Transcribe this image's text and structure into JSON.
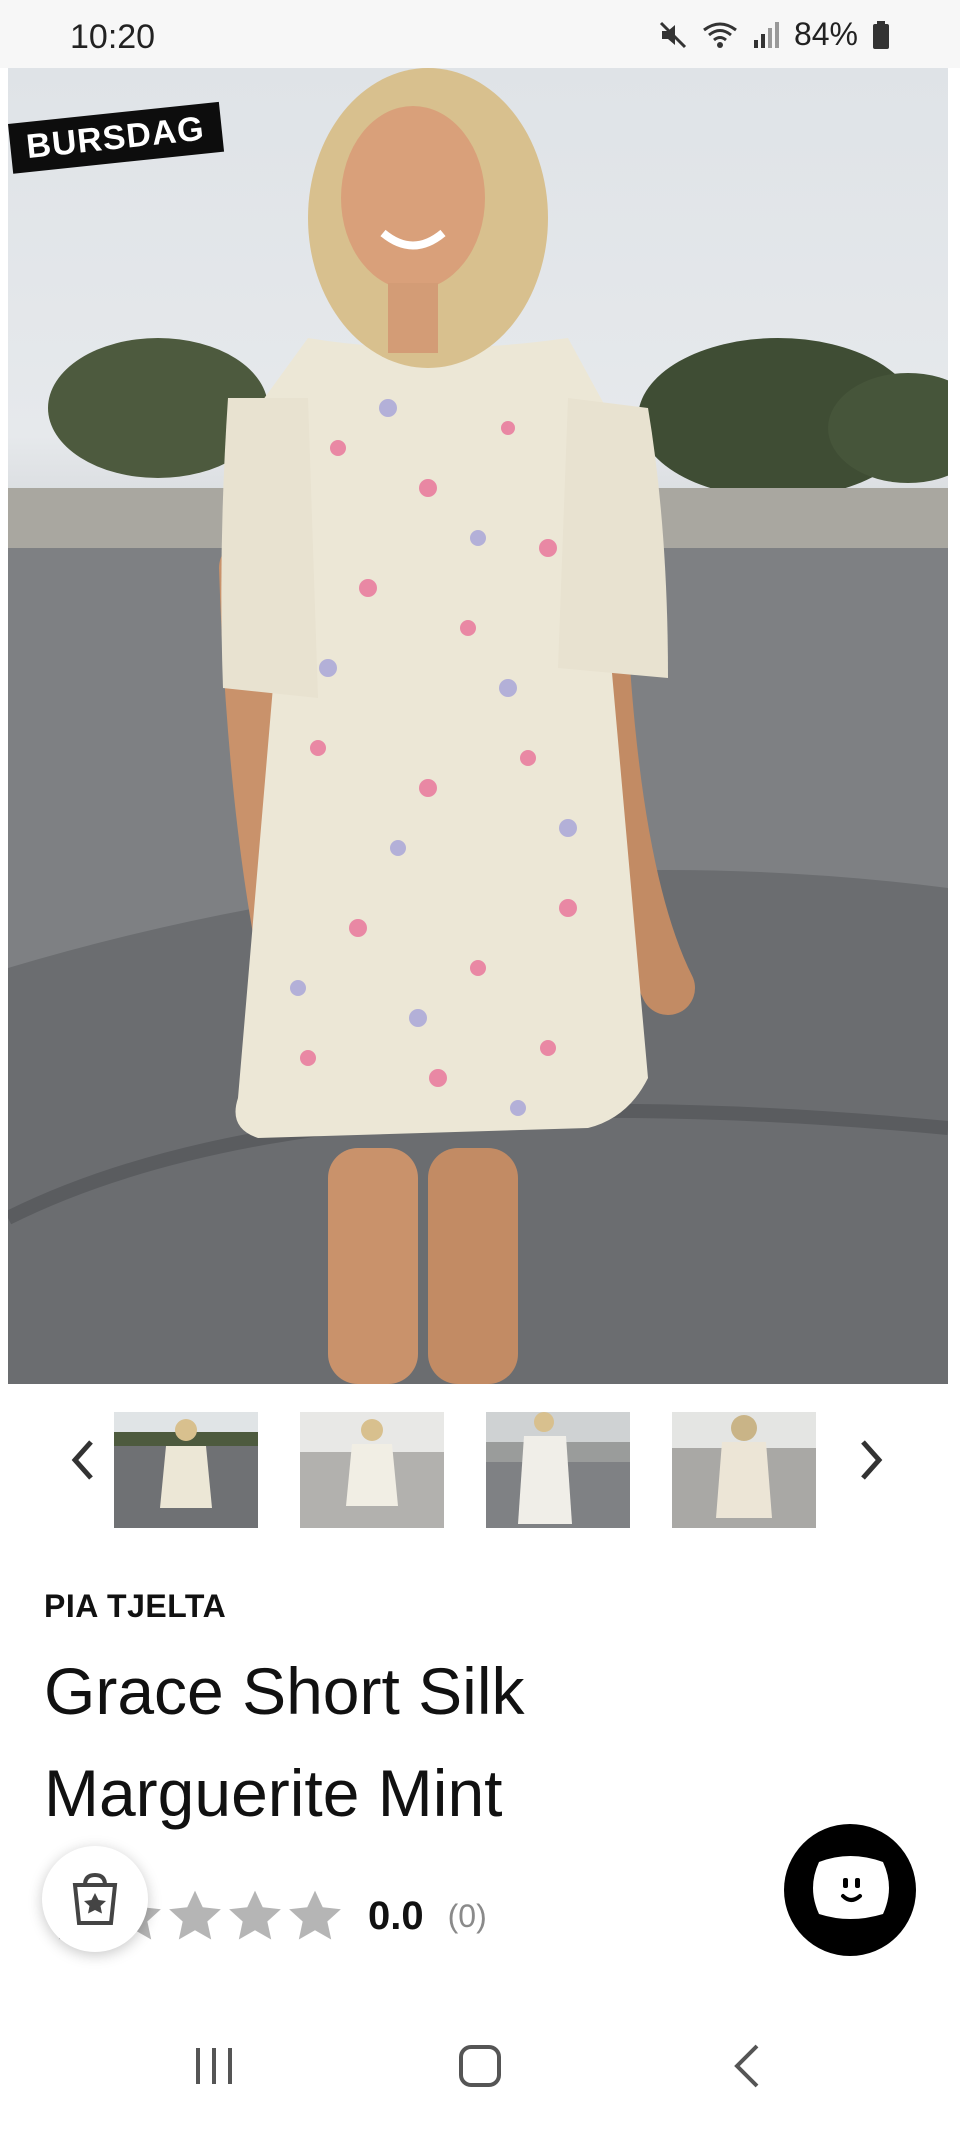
{
  "status_bar": {
    "time": "10:20",
    "battery": "84%",
    "icons": [
      "mute-icon",
      "wifi-icon",
      "signal-icon",
      "battery-icon"
    ]
  },
  "hero": {
    "badge": "BURSDAG",
    "image": "model-in-floral-dress-photo"
  },
  "gallery": {
    "thumbnails": [
      "thumbnail-1",
      "thumbnail-2",
      "thumbnail-3",
      "thumbnail-4"
    ],
    "prev_icon": "chevron-left-icon",
    "next_icon": "chevron-right-icon"
  },
  "product": {
    "brand": "PIA TJELTA",
    "title_line1": "Grace Short Silk",
    "title_line2": "Marguerite Mint",
    "rating_value": "0.0",
    "rating_count": "(0)",
    "stars_filled": 0,
    "stars_total": 5
  },
  "colors": {
    "star_empty": "#b5b5b5",
    "chat_fab": "#000000",
    "badge_bg": "#0d0d0d"
  },
  "nav_bar": {
    "icons": [
      "recent-apps-icon",
      "home-icon",
      "back-icon"
    ]
  }
}
